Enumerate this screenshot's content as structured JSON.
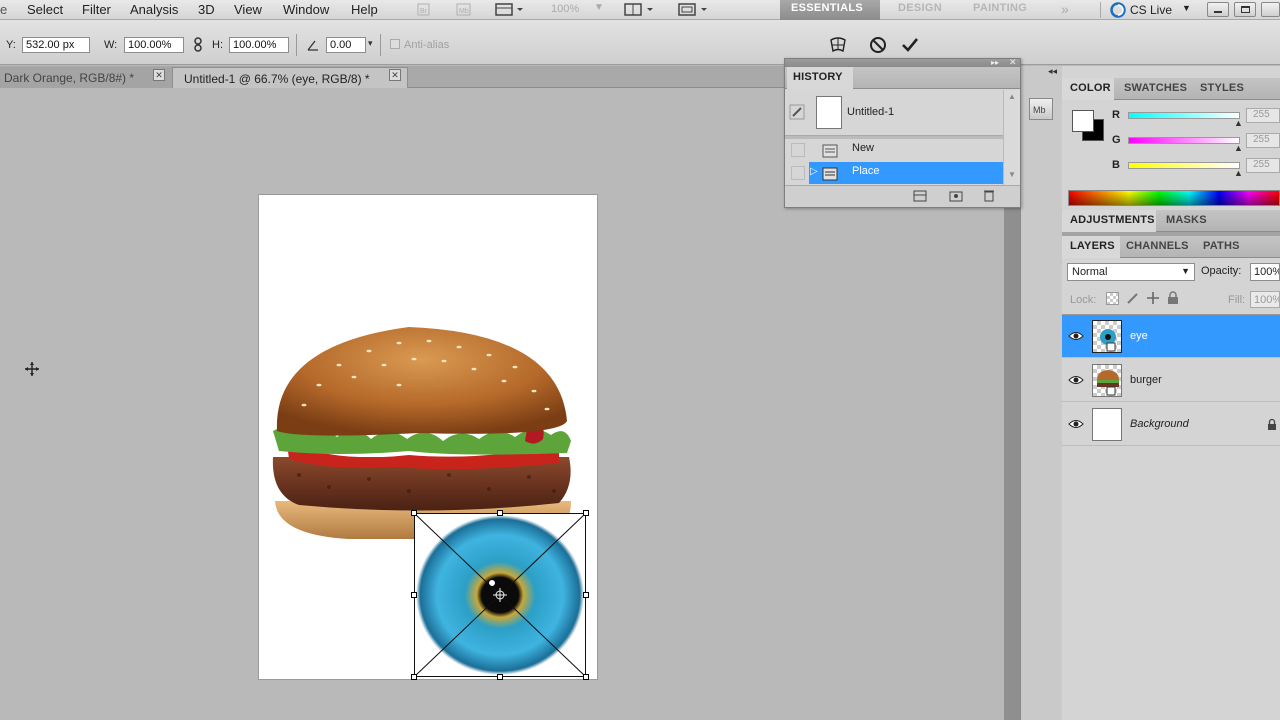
{
  "menubar": {
    "items": [
      "Select",
      "Filter",
      "Analysis",
      "3D",
      "View",
      "Window",
      "Help"
    ],
    "zoom": "100%",
    "workspaces": [
      "ESSENTIALS",
      "DESIGN",
      "PAINTING"
    ],
    "cs_live": "CS Live"
  },
  "options": {
    "y_label": "Y:",
    "y_value": "532.00 px",
    "w_label": "W:",
    "w_value": "100.00%",
    "h_label": "H:",
    "h_value": "100.00%",
    "angle_value": "0.00",
    "antialias": "Anti-alias"
  },
  "tabs": [
    {
      "label": "Dark Orange, RGB/8#) *"
    },
    {
      "label": "Untitled-1 @ 66.7% (eye, RGB/8) *"
    }
  ],
  "history": {
    "title": "HISTORY",
    "snapshot": "Untitled-1",
    "items": [
      "New",
      "Place"
    ],
    "selected": "Place"
  },
  "color_panel": {
    "tabs": [
      "COLOR",
      "SWATCHES",
      "STYLES"
    ],
    "channels": [
      {
        "label": "R",
        "value": "255"
      },
      {
        "label": "G",
        "value": "255"
      },
      {
        "label": "B",
        "value": "255"
      }
    ]
  },
  "adjust_panel": {
    "tabs": [
      "ADJUSTMENTS",
      "MASKS"
    ]
  },
  "layers_panel": {
    "tabs": [
      "LAYERS",
      "CHANNELS",
      "PATHS"
    ],
    "blend_mode": "Normal",
    "opacity_label": "Opacity:",
    "opacity_value": "100%",
    "lock_label": "Lock:",
    "fill_label": "Fill:",
    "fill_value": "100%",
    "layers": [
      {
        "name": "eye",
        "selected": true
      },
      {
        "name": "burger",
        "selected": false
      },
      {
        "name": "Background",
        "selected": false,
        "locked": true
      }
    ]
  },
  "colors": {
    "selection": "#3399ff",
    "workspace_text": "#ffffff"
  }
}
